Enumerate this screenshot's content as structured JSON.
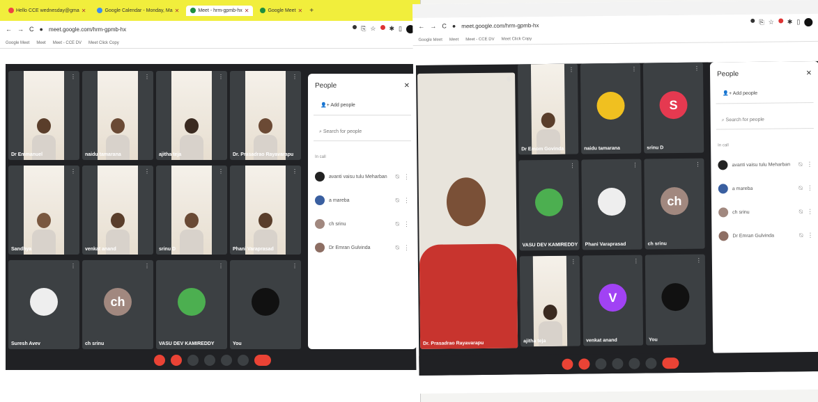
{
  "left": {
    "tabs": [
      {
        "label": "Hello CCE wednesday@gma"
      },
      {
        "label": "Google Calendar - Monday, Ma"
      },
      {
        "label": "Meet - hrm-gpmb-hx"
      },
      {
        "label": "Google Meet"
      }
    ],
    "url": "meet.google.com/hrm-gpmb-hx",
    "bookmarks": [
      "Google Meet",
      "Meet",
      "Meet - CCE DV",
      "Meet Click Copy"
    ],
    "tiles": [
      {
        "name": "Dr Emmanuel",
        "type": "video",
        "skin": "#5a3e2b"
      },
      {
        "name": "naidu tamarana",
        "type": "video",
        "skin": "#6a4a35"
      },
      {
        "name": "ajitha teja",
        "type": "video",
        "skin": "#3a2a20"
      },
      {
        "name": "Dr. Prasadrao Rayavarapu",
        "type": "video",
        "skin": "#6b4a35"
      },
      {
        "name": "Sandhya",
        "type": "video",
        "skin": "#7a5840"
      },
      {
        "name": "venkat anand",
        "type": "video",
        "skin": "#5a3e2b"
      },
      {
        "name": "srinu D",
        "type": "video",
        "skin": "#6a4a35"
      },
      {
        "name": "Phani Varaprasad",
        "type": "video",
        "skin": "#5a3e2b"
      },
      {
        "name": "Suresh Avev",
        "type": "photo",
        "color": "#eee"
      },
      {
        "name": "ch srinu",
        "type": "letter",
        "letter": "ch",
        "color": "#a1887f"
      },
      {
        "name": "VASU DEV KAMIREDDY",
        "type": "photo",
        "color": "#4caf50"
      },
      {
        "name": "You",
        "type": "photo",
        "color": "#111"
      }
    ],
    "people": {
      "title": "People",
      "add_label": "Add people",
      "search_placeholder": "Search for people",
      "in_call_label": "In call",
      "rows": [
        {
          "name": "avanti vaisu tulu Meharban",
          "color": "#222"
        },
        {
          "name": "a mareba",
          "color": "#3a5fa0"
        },
        {
          "name": "ch srinu",
          "color": "#a1887f"
        },
        {
          "name": "Dr Emran Gulvinda",
          "color": "#8d6e63"
        }
      ]
    }
  },
  "right": {
    "url": "meet.google.com/hrm-gpmb-hx",
    "bookmarks": [
      "Google Meet",
      "Meet",
      "Meet - CCE DV",
      "Meet Click Copy"
    ],
    "spotlight_name": "Dr. Prasadrao Rayavarapu",
    "tiles": [
      {
        "name": "Dr Emom Govinda",
        "type": "video",
        "skin": "#5a3e2b"
      },
      {
        "name": "naidu tamarana",
        "type": "photo",
        "color": "#f0c020"
      },
      {
        "name": "srinu D",
        "type": "letter",
        "letter": "S",
        "color": "#e53950"
      },
      {
        "name": "VASU DEV KAMIREDDY",
        "type": "photo",
        "color": "#4caf50"
      },
      {
        "name": "Phani Varaprasad",
        "type": "photo",
        "color": "#eee"
      },
      {
        "name": "ch srinu",
        "type": "letter",
        "letter": "ch",
        "color": "#a1887f"
      },
      {
        "name": "ajitha teja",
        "type": "video",
        "skin": "#3a2a20"
      },
      {
        "name": "venkat anand",
        "type": "letter",
        "letter": "V",
        "color": "#a142f4"
      },
      {
        "name": "You",
        "type": "photo",
        "color": "#111"
      }
    ],
    "people": {
      "title": "People",
      "add_label": "Add people",
      "search_placeholder": "Search for people",
      "in_call_label": "In call",
      "rows": [
        {
          "name": "avanti vaisu tulu Meharban",
          "color": "#222"
        },
        {
          "name": "a mareba",
          "color": "#3a5fa0"
        },
        {
          "name": "ch srinu",
          "color": "#a1887f"
        },
        {
          "name": "Dr Emran Gulvinda",
          "color": "#8d6e63"
        }
      ]
    }
  }
}
